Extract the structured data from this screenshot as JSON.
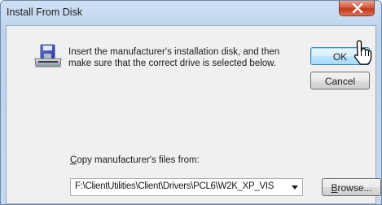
{
  "window": {
    "title": "Install From Disk"
  },
  "dialog": {
    "instruction": "Insert the manufacturer's installation disk, and then make sure that the correct drive is selected below.",
    "ok_label": "OK",
    "cancel_label": "Cancel",
    "copy_from_label_prefix": "C",
    "copy_from_label_rest": "opy manufacturer's files from:",
    "path_value": "F:\\ClientUtilities\\Client\\Drivers\\PCL6\\W2K_XP_VIS",
    "browse_label_prefix": "B",
    "browse_label_rest": "rowse..."
  },
  "icons": {
    "close": "close-icon",
    "disk": "floppy-disk-drive-icon",
    "dropdown": "chevron-down-icon",
    "cursor": "mouse-pointer-icon"
  },
  "colors": {
    "title_bar": "#bcd3ee",
    "close_button": "#c2381b",
    "default_button_border": "#3c7fb1",
    "dialog_background": "#f0f0f0"
  }
}
